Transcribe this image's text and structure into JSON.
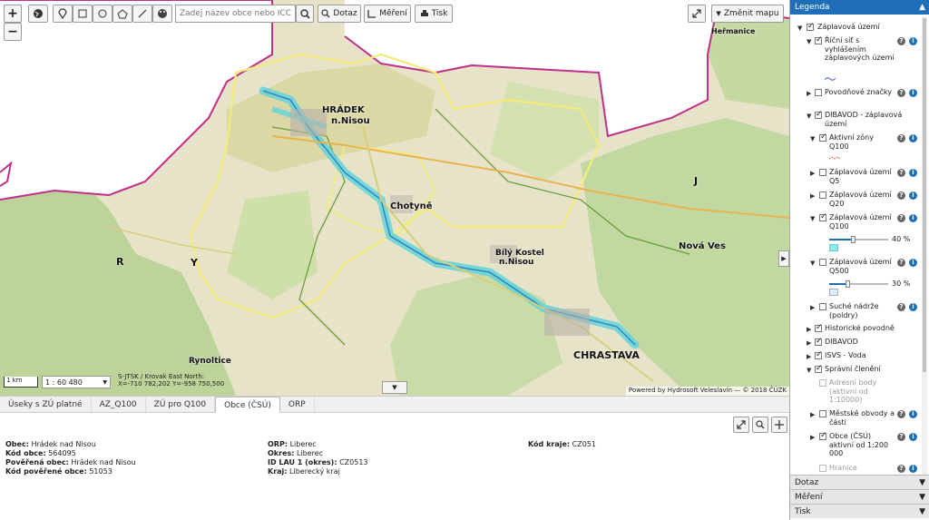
{
  "toolbar": {
    "search_placeholder": "Zadej název obce nebo ICC",
    "query_label": "Dotaz",
    "measure_label": "Měření",
    "print_label": "Tisk",
    "change_map_label": "Změnit mapu"
  },
  "map": {
    "labels": {
      "hradek": "HRÁDEK",
      "nnisou": "n.Nisou",
      "chotyne": "Chotyně",
      "bily": "Bílý Kostel",
      "bily2": "n.Nisou",
      "chrastava": "CHRASTAVA",
      "nova_ves": "Nová Ves",
      "rynoltice": "Rynoltice",
      "hermanice": "Heřmanice",
      "j": "J",
      "r": "R",
      "y": "Y"
    },
    "scale_bar": "1 km",
    "scale": "1 : 60 480",
    "coords_line1": "S-JTSK / Krovak East North:",
    "coords_line2": "X=-710 782,202 Y=-958 750,500",
    "attribution": "Powered by Hydrosoft Veleslavín — © 2018 ČÚZK"
  },
  "tabs": [
    "Úseky s ZÚ platné",
    "AZ_Q100",
    "ZÚ pro Q100",
    "Obce (ČSÚ)",
    "ORP"
  ],
  "active_tab": "Obce (ČSÚ)",
  "info": {
    "col1": [
      {
        "k": "Obec:",
        "v": "Hrádek nad Nisou"
      },
      {
        "k": "Kód obce:",
        "v": "564095"
      },
      {
        "k": "Pověřená obec:",
        "v": "Hrádek nad Nisou"
      },
      {
        "k": "Kód pověřené obce:",
        "v": "51053"
      }
    ],
    "col2": [
      {
        "k": "ORP:",
        "v": "Liberec"
      },
      {
        "k": "Okres:",
        "v": "Liberec"
      },
      {
        "k": "ID LAU 1 (okres):",
        "v": "CZ0513"
      },
      {
        "k": "Kraj:",
        "v": "Liberecký kraj"
      }
    ],
    "col3": [
      {
        "k": "Kód kraje:",
        "v": "CZ051"
      }
    ]
  },
  "legend": {
    "title": "Legenda",
    "items": {
      "zaplavova": "Záplavová území",
      "ricni": "Říční síť s vyhlášením záplavových území",
      "povodnove": "Povodňové značky",
      "dibavod_zap": "DIBAVOD - záplavová území",
      "aktivni": "Aktivní zóny Q100",
      "q5": "Záplavová území Q5",
      "q20": "Záplavová území Q20",
      "q100": "Záplavová území Q100",
      "q100_pct": "40 %",
      "q500": "Záplavová území Q500",
      "q500_pct": "30 %",
      "suche": "Suché nádrže (poldry)",
      "historicke": "Historické povodně",
      "dibavod": "DIBAVOD",
      "isvs": "ISVS - Voda",
      "spravni": "Správní členění",
      "adresni": "Adresní body (aktivní od 1:10000)",
      "mestske": "Městské obvody a části",
      "obce": "Obce (ČSÚ) aktivní od 1:200 000",
      "hranice": "Hranice"
    },
    "q100_opacity": 0.4,
    "q500_opacity": 0.3,
    "footer": [
      "Dotaz",
      "Měření",
      "Tisk"
    ]
  }
}
